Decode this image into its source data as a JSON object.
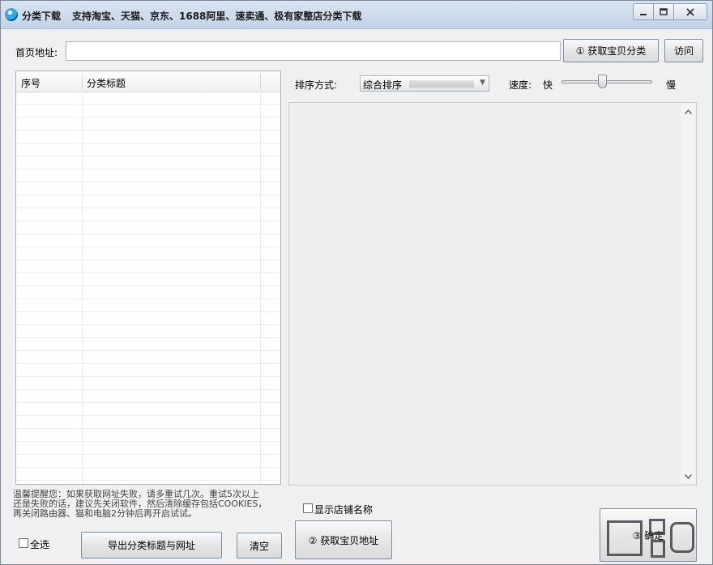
{
  "window": {
    "title": "分类下载",
    "subtitle": "支持淘宝、天猫、京东、1688阿里、速卖通、极有家整店分类下载",
    "controls": [
      "minimize",
      "maximize",
      "close"
    ]
  },
  "url_row": {
    "label": "首页地址:",
    "value": "",
    "get_category_button": "① 获取宝贝分类",
    "visit_button": "访问"
  },
  "grid": {
    "columns": [
      "序号",
      "分类标题"
    ],
    "rows": []
  },
  "hint": {
    "line1": "温馨提醒您：如果获取网址失败，请多重试几次。重试5次以上",
    "line2": "还是失败的话，建议先关闭软件，然后清除缓存包括COOKIES，",
    "line3": "再关闭路由器、猫和电脑2分钟后再开启试试。"
  },
  "bottom_left": {
    "select_all_label": "全选",
    "select_all_checked": false,
    "export_button": "导出分类标题与网址",
    "clear_button": "清空"
  },
  "sort": {
    "label": "排序方式:",
    "selected": "综合排序"
  },
  "speed": {
    "label": "速度:",
    "fast_label": "快",
    "slow_label": "慢",
    "level": 0.45
  },
  "show_shop_name": {
    "label": "显示店铺名称",
    "checked": false
  },
  "actions": {
    "get_urls_button": "② 获取宝贝地址",
    "confirm_button": "③ 确定"
  },
  "icons": {
    "app": "app-logo-icon",
    "minimize": "minimize-icon",
    "maximize": "maximize-icon",
    "close": "close-icon",
    "dropdown": "chevron-down-icon",
    "scroll_up": "scroll-up-icon",
    "scroll_down": "scroll-down-icon"
  },
  "colors": {
    "titlebar": "#c9d8ea",
    "window_bg": "#f0f0f0",
    "border": "#7d8fa4"
  }
}
